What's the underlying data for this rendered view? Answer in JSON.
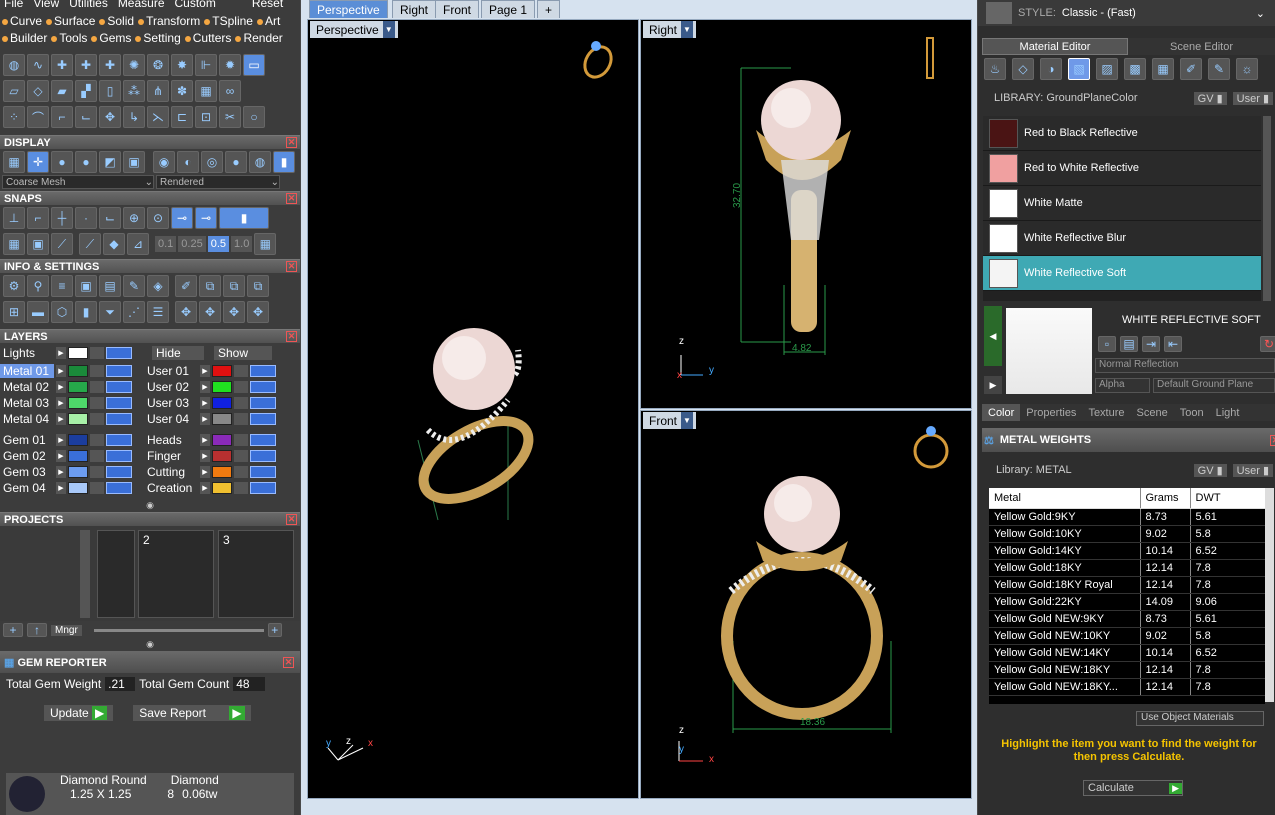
{
  "menu": {
    "top": [
      "File",
      "View",
      "Utilities",
      "Measure",
      "Custom",
      "Reset"
    ],
    "row2": [
      "Curve",
      "Surface",
      "Solid",
      "Transform",
      "TSpline",
      "Art"
    ],
    "row3": [
      "Builder",
      "Tools",
      "Gems",
      "Setting",
      "Cutters",
      "Render"
    ]
  },
  "display": {
    "title": "DISPLAY",
    "mesh": "Coarse Mesh",
    "render": "Rendered"
  },
  "snaps": {
    "title": "SNAPS",
    "values": [
      "0.1",
      "0.25",
      "0.5",
      "1.0"
    ]
  },
  "info": {
    "title": "INFO & SETTINGS"
  },
  "layers": {
    "title": "LAYERS",
    "lights": "Lights",
    "hide": "Hide",
    "show": "Show",
    "left": [
      {
        "name": "Metal 01",
        "color": "#1a8a3a"
      },
      {
        "name": "Metal 02",
        "color": "#26a84a"
      },
      {
        "name": "Metal 03",
        "color": "#4ed96a"
      },
      {
        "name": "Metal 04",
        "color": "#a8f0a8"
      },
      {
        "name": "Gem 01",
        "color": "#1b3d9e"
      },
      {
        "name": "Gem 02",
        "color": "#3a6fd8"
      },
      {
        "name": "Gem 03",
        "color": "#6c9cf0"
      },
      {
        "name": "Gem 04",
        "color": "#a8c8f8"
      }
    ],
    "right": [
      {
        "name": "User 01",
        "color": "#e01010"
      },
      {
        "name": "User 02",
        "color": "#20e020"
      },
      {
        "name": "User 03",
        "color": "#1020e0"
      },
      {
        "name": "User 04",
        "color": "#888888"
      },
      {
        "name": "Heads",
        "color": "#8a2ab8"
      },
      {
        "name": "Finger",
        "color": "#b83030"
      },
      {
        "name": "Cutting",
        "color": "#f07a10"
      },
      {
        "name": "Creation",
        "color": "#f0c030"
      }
    ]
  },
  "projects": {
    "title": "PROJECTS",
    "slots": [
      "2",
      "3"
    ],
    "mngr": "Mngr"
  },
  "gem_reporter": {
    "title": "GEM REPORTER",
    "weight_label": "Total Gem Weight",
    "weight": ".21",
    "count_label": "Total Gem Count",
    "count": "48",
    "update": "Update",
    "save": "Save Report",
    "row_a": [
      "Diamond Round",
      "Diamond"
    ],
    "row_b": [
      "1.25 X 1.25",
      "8",
      "0.06tw"
    ]
  },
  "viewports": {
    "tabs": [
      "Perspective",
      "Right",
      "Front",
      "Page 1"
    ],
    "perspective_label": "Perspective",
    "right_label": "Right",
    "front_label": "Front",
    "dim_height": "32.70",
    "dim_width_right": "4.82",
    "dim_width_front": "18.36"
  },
  "right_panel": {
    "style_label": "STYLE:",
    "style_value": "Classic - (Fast)",
    "tabs": [
      "Material Editor",
      "Scene Editor"
    ],
    "library_label": "LIBRARY: GroundPlaneColor",
    "gv": "GV",
    "user": "User",
    "materials": [
      {
        "name": "Red to Black Reflective",
        "color": "#4a1414"
      },
      {
        "name": "Red to White Reflective",
        "color": "#f0a0a0"
      },
      {
        "name": "White Matte",
        "color": "#ffffff"
      },
      {
        "name": "White Reflective Blur",
        "color": "#ffffff"
      },
      {
        "name": "White Reflective Soft",
        "color": "#f4f4f4"
      }
    ],
    "selected_material": "WHITE REFLECTIVE SOFT",
    "reflection": "Normal Reflection",
    "alpha": "Alpha",
    "ground": "Default Ground Plane",
    "bottom_tabs": [
      "Color",
      "Properties",
      "Texture",
      "Scene",
      "Toon",
      "Light"
    ]
  },
  "metal_weights": {
    "title": "METAL WEIGHTS",
    "library": "Library: METAL",
    "headers": [
      "Metal",
      "Grams",
      "DWT"
    ],
    "rows": [
      [
        "Yellow Gold:9KY",
        "8.73",
        "5.61"
      ],
      [
        "Yellow Gold:10KY",
        "9.02",
        "5.8"
      ],
      [
        "Yellow Gold:14KY",
        "10.14",
        "6.52"
      ],
      [
        "Yellow Gold:18KY",
        "12.14",
        "7.8"
      ],
      [
        "Yellow Gold:18KY Royal",
        "12.14",
        "7.8"
      ],
      [
        "Yellow Gold:22KY",
        "14.09",
        "9.06"
      ],
      [
        "Yellow Gold NEW:9KY",
        "8.73",
        "5.61"
      ],
      [
        "Yellow Gold NEW:10KY",
        "9.02",
        "5.8"
      ],
      [
        "Yellow Gold NEW:14KY",
        "10.14",
        "6.52"
      ],
      [
        "Yellow Gold NEW:18KY",
        "12.14",
        "7.8"
      ],
      [
        "Yellow Gold NEW:18KY...",
        "12.14",
        "7.8"
      ]
    ],
    "use_object": "Use Object Materials",
    "hint": "Highlight the item you want to find the weight for then press Calculate.",
    "calculate": "Calculate"
  }
}
